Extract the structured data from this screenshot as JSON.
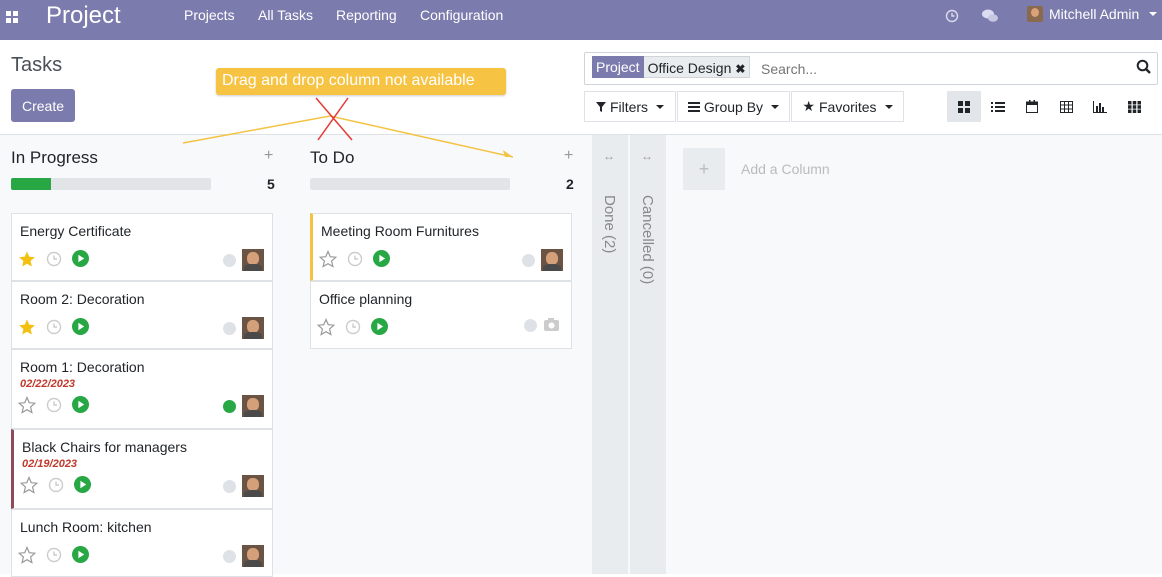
{
  "topbar": {
    "brand": "Project",
    "menu": [
      "Projects",
      "All Tasks",
      "Reporting",
      "Configuration"
    ],
    "user": "Mitchell Admin"
  },
  "control_panel": {
    "title": "Tasks",
    "create_label": "Create",
    "facet_label": "Project",
    "facet_value": "Office Design",
    "search_placeholder": "Search...",
    "filters_label": "Filters",
    "groupby_label": "Group By",
    "favorites_label": "Favorites"
  },
  "annotation": {
    "tooltip": "Drag and drop column not available"
  },
  "columns": [
    {
      "title": "In Progress",
      "count": "5",
      "progress": 0.2,
      "cards": [
        {
          "name": "Energy Certificate",
          "date": "",
          "starred": true,
          "status": "grey"
        },
        {
          "name": "Room 2: Decoration",
          "date": "",
          "starred": true,
          "status": "grey"
        },
        {
          "name": "Room 1: Decoration",
          "date": "02/22/2023",
          "starred": false,
          "status": "green"
        },
        {
          "name": "Black Chairs for managers",
          "date": "02/19/2023",
          "starred": false,
          "status": "grey"
        },
        {
          "name": "Lunch Room: kitchen",
          "date": "",
          "starred": false,
          "status": "grey"
        }
      ]
    },
    {
      "title": "To Do",
      "count": "2",
      "progress": 0,
      "cards": [
        {
          "name": "Meeting Room Furnitures",
          "date": "",
          "starred": false,
          "status": "grey"
        },
        {
          "name": "Office planning",
          "date": "",
          "starred": false,
          "status": "grey"
        }
      ]
    }
  ],
  "folded_columns": [
    "Done (2)",
    "Cancelled (0)"
  ],
  "add_column_label": "Add a Column",
  "colors": {
    "brand": "#7c7bad",
    "star": "#f3c010",
    "play": "#28a745",
    "date": "#c0392b",
    "tooltip": "#f6c343"
  }
}
